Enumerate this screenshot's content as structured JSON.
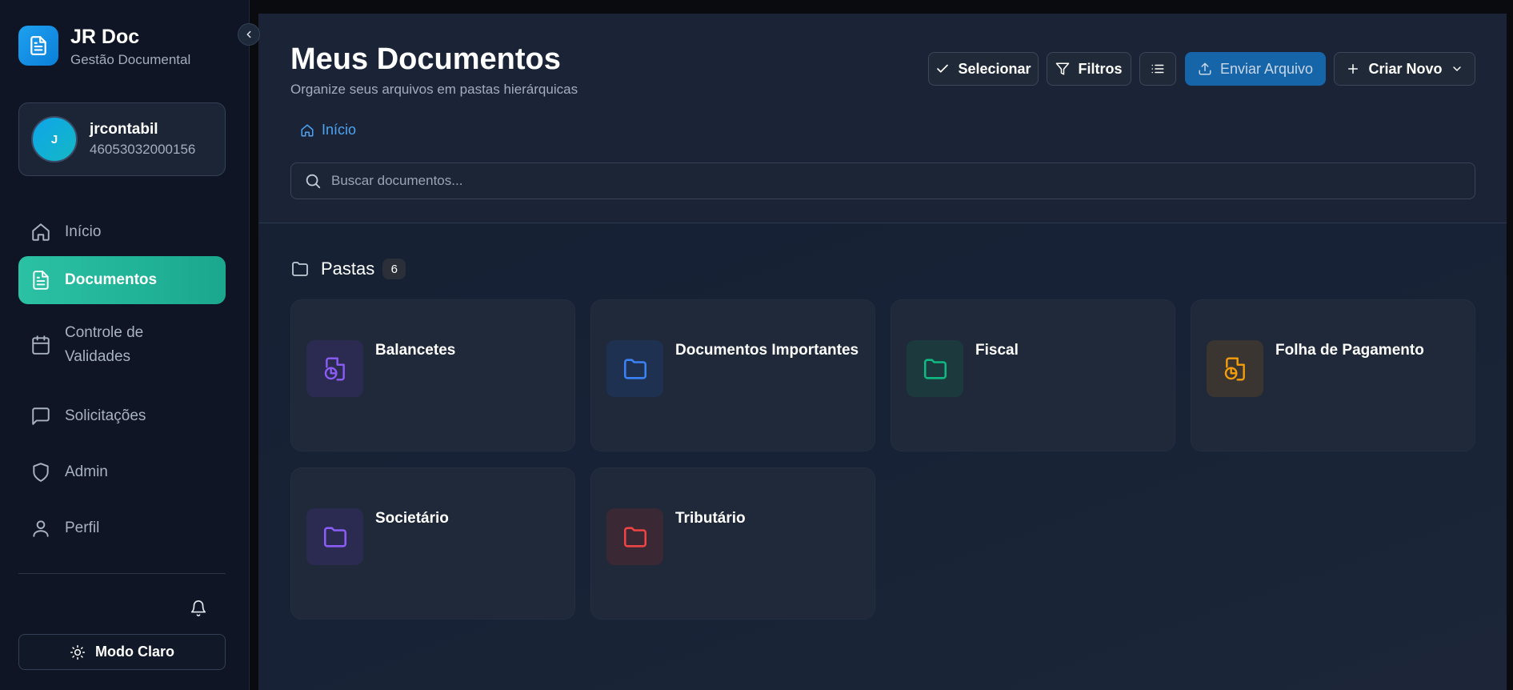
{
  "brand": {
    "title": "JR Doc",
    "subtitle": "Gestão Documental",
    "logo_icon": "document-icon"
  },
  "user": {
    "initial": "J",
    "name": "jrcontabil",
    "id": "46053032000156"
  },
  "nav": {
    "items": [
      {
        "label": "Início",
        "icon": "home-icon",
        "active": false
      },
      {
        "label": "Documentos",
        "icon": "document-icon",
        "active": true
      },
      {
        "label": "Controle de Validades",
        "icon": "calendar-icon",
        "active": false
      },
      {
        "label": "Solicitações",
        "icon": "chat-icon",
        "active": false
      },
      {
        "label": "Admin",
        "icon": "shield-icon",
        "active": false
      },
      {
        "label": "Perfil",
        "icon": "user-icon",
        "active": false
      }
    ]
  },
  "theme_toggle": {
    "label": "Modo Claro",
    "icon": "sun-icon"
  },
  "header": {
    "title": "Meus Documentos",
    "subtitle": "Organize seus arquivos em pastas hierárquicas"
  },
  "toolbar": {
    "select_label": "Selecionar",
    "filters_label": "Filtros",
    "upload_label": "Enviar Arquivo",
    "create_label": "Criar Novo"
  },
  "breadcrumb": {
    "home_label": "Início"
  },
  "search": {
    "placeholder": "Buscar documentos..."
  },
  "folders_section": {
    "title": "Pastas",
    "count": "6"
  },
  "folders": [
    {
      "name": "Balancetes",
      "icon": "file-chart-icon",
      "color": "#8b5cf6",
      "bg": "#2b2b52"
    },
    {
      "name": "Documentos Importantes",
      "icon": "folder-icon",
      "color": "#3b82f6",
      "bg": "#1f3150"
    },
    {
      "name": "Fiscal",
      "icon": "folder-icon",
      "color": "#10b981",
      "bg": "#1c3a3e"
    },
    {
      "name": "Folha de Pagamento",
      "icon": "file-chart-icon",
      "color": "#f59e0b",
      "bg": "#3a3530"
    },
    {
      "name": "Societário",
      "icon": "folder-icon",
      "color": "#8b5cf6",
      "bg": "#2b2b52"
    },
    {
      "name": "Tributário",
      "icon": "folder-icon",
      "color": "#ef4444",
      "bg": "#3a2834"
    }
  ]
}
